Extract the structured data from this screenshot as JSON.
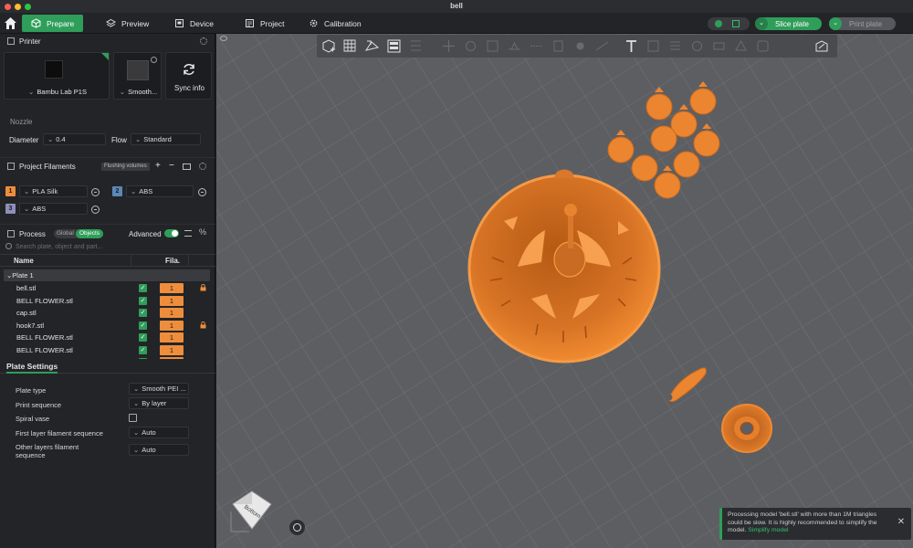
{
  "window": {
    "title": "bell"
  },
  "colors": {
    "accent": "#2f9e5a",
    "filament_orange": "#ee8e3c",
    "filament_blue": "#5d87b6",
    "filament_purple": "#8e8fba"
  },
  "nav": {
    "tabs": [
      {
        "label": "Prepare",
        "icon": "cube-icon",
        "active": true
      },
      {
        "label": "Preview",
        "icon": "layers-icon"
      },
      {
        "label": "Device",
        "icon": "device-icon"
      },
      {
        "label": "Project",
        "icon": "project-icon"
      },
      {
        "label": "Calibration",
        "icon": "calibration-icon"
      }
    ],
    "slice_label": "Slice plate",
    "print_label": "Print plate"
  },
  "printer": {
    "header": "Printer",
    "name": "Bambu Lab P1S",
    "plate_short": "Smooth...",
    "sync_label": "Sync info",
    "nozzle_label": "Nozzle",
    "diameter_label": "Diameter",
    "diameter_value": "0.4",
    "flow_label": "Flow",
    "flow_value": "Standard"
  },
  "filaments": {
    "header": "Project Filaments",
    "flushing_label": "Flushing volumes",
    "items": [
      {
        "index": "1",
        "name": "PLA Silk",
        "color": "#ee8e3c"
      },
      {
        "index": "2",
        "name": "ABS",
        "color": "#5d87b6"
      },
      {
        "index": "3",
        "name": "ABS",
        "color": "#8e8fba"
      }
    ]
  },
  "process": {
    "header": "Process",
    "global_label": "Global",
    "objects_label": "Objects",
    "advanced_label": "Advanced",
    "search_placeholder": "Search plate, object and part..."
  },
  "objects": {
    "col_name": "Name",
    "col_fila": "Fila.",
    "plate": "Plate 1",
    "rows": [
      {
        "name": "bell.stl",
        "fila": "1",
        "locked": true
      },
      {
        "name": "BELL FLOWER.stl",
        "fila": "1",
        "locked": false
      },
      {
        "name": "cap.stl",
        "fila": "1",
        "locked": false
      },
      {
        "name": "hook7.stl",
        "fila": "1",
        "locked": true
      },
      {
        "name": "BELL FLOWER.stl",
        "fila": "1",
        "locked": false
      },
      {
        "name": "BELL FLOWER.stl",
        "fila": "1",
        "locked": false
      },
      {
        "name": "BELL FLOWER.stl",
        "fila": "1",
        "locked": false
      }
    ]
  },
  "plate_settings": {
    "header": "Plate Settings",
    "plate_type_label": "Plate type",
    "plate_type_value": "Smooth PEI ...",
    "print_seq_label": "Print sequence",
    "print_seq_value": "By layer",
    "spiral_label": "Spiral vase",
    "first_layer_label": "First layer filament sequence",
    "first_layer_value": "Auto",
    "other_layers_label": "Other layers filament sequence",
    "other_layers_value": "Auto"
  },
  "viewport": {
    "cube_label": "Bottom"
  },
  "notification": {
    "text": "Processing model 'bell.stl' with more than 1M triangles could be slow. It is highly recommended to simplify the model.",
    "link": "Simplify model"
  }
}
